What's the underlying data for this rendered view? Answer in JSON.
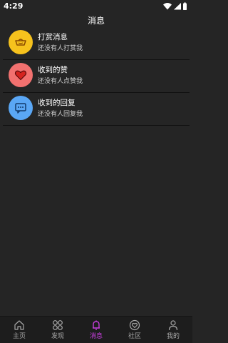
{
  "status_bar": {
    "time": "4:29"
  },
  "header": {
    "title": "消息"
  },
  "messages": [
    {
      "title": "打赏消息",
      "subtitle": "还没有人打赏我",
      "icon": "gold-ingot-icon",
      "color": "#f6c21d"
    },
    {
      "title": "收到的赞",
      "subtitle": "还没有人点赞我",
      "icon": "heart-icon",
      "color": "#f2716f"
    },
    {
      "title": "收到的回复",
      "subtitle": "还没有人回复我",
      "icon": "chat-icon",
      "color": "#5aa7f5"
    }
  ],
  "bottom_nav": {
    "items": [
      {
        "label": "主页",
        "icon": "home-icon"
      },
      {
        "label": "发现",
        "icon": "grid-icon"
      },
      {
        "label": "消息",
        "icon": "bell-icon",
        "active": true
      },
      {
        "label": "社区",
        "icon": "community-heart-icon"
      },
      {
        "label": "我的",
        "icon": "person-icon"
      }
    ]
  },
  "colors": {
    "background": "#252525",
    "nav_background": "#1d1d1d",
    "accent": "#d040e8"
  }
}
